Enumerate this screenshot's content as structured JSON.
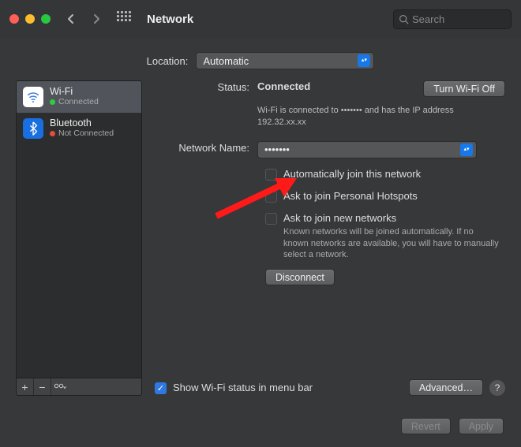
{
  "titlebar": {
    "title": "Network",
    "search_placeholder": "Search"
  },
  "location": {
    "label": "Location:",
    "value": "Automatic"
  },
  "sidebar": {
    "items": [
      {
        "label": "Wi-Fi",
        "status": "Connected",
        "status_color": "green"
      },
      {
        "label": "Bluetooth",
        "status": "Not Connected",
        "status_color": "red"
      }
    ]
  },
  "status": {
    "label": "Status:",
    "value": "Connected",
    "toggle_button": "Turn Wi-Fi Off",
    "subtext_a": "Wi-Fi is connected to",
    "subtext_mask": "•••••••",
    "subtext_b": "and has the IP address",
    "ip": "192.32.xx.xx"
  },
  "network_name": {
    "label": "Network Name:",
    "value": "•••••••"
  },
  "checks": {
    "auto_join": "Automatically join this network",
    "hotspots": "Ask to join Personal Hotspots",
    "new_nets": "Ask to join new networks",
    "new_nets_sub": "Known networks will be joined automatically. If no known networks are available, you will have to manually select a network."
  },
  "buttons": {
    "disconnect": "Disconnect",
    "show_menu": "Show Wi-Fi status in menu bar",
    "advanced": "Advanced…",
    "revert": "Revert",
    "apply": "Apply"
  }
}
